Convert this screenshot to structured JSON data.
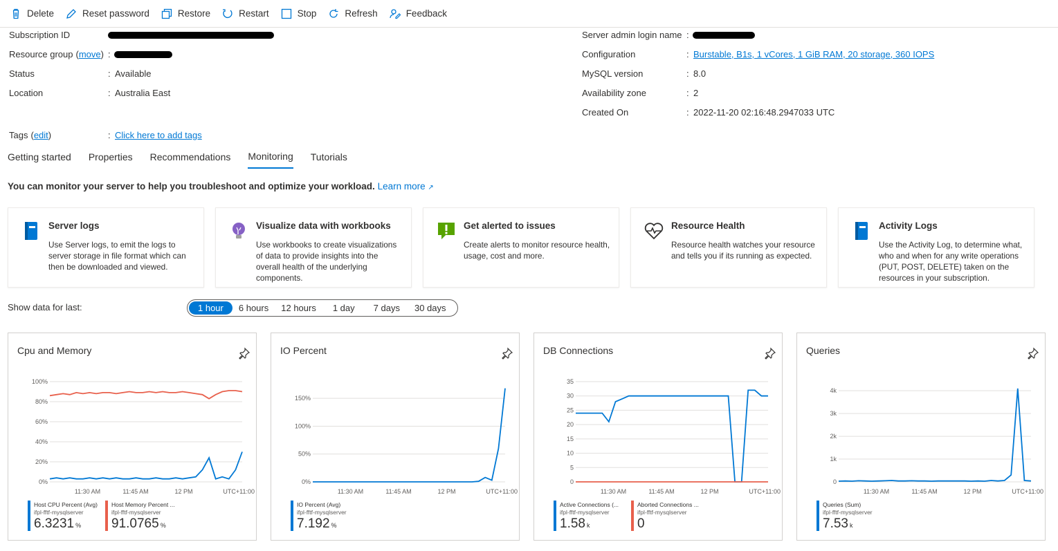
{
  "toolbar": {
    "delete": "Delete",
    "reset_password": "Reset password",
    "restore": "Restore",
    "restart": "Restart",
    "stop": "Stop",
    "refresh": "Refresh",
    "feedback": "Feedback"
  },
  "essentials": {
    "subscription_id_label": "Subscription ID",
    "resource_group_label": "Resource group",
    "move_link": "move",
    "status_label": "Status",
    "status_value": "Available",
    "location_label": "Location",
    "location_value": "Australia East",
    "admin_login_label": "Server admin login name",
    "configuration_label": "Configuration",
    "configuration_value": "Burstable, B1s, 1 vCores, 1 GiB RAM, 20 storage, 360 IOPS",
    "mysql_version_label": "MySQL version",
    "mysql_version_value": "8.0",
    "availability_zone_label": "Availability zone",
    "availability_zone_value": "2",
    "created_on_label": "Created On",
    "created_on_value": "2022-11-20 02:16:48.2947033 UTC",
    "tags_label": "Tags",
    "tags_edit_link": "edit",
    "tags_value": "Click here to add tags",
    "separator": ":"
  },
  "tabs": [
    "Getting started",
    "Properties",
    "Recommendations",
    "Monitoring",
    "Tutorials"
  ],
  "intro": {
    "text": "You can monitor your server to help you troubleshoot and optimize your workload.",
    "learn_more": "Learn more"
  },
  "cards": [
    {
      "title": "Server logs",
      "desc": "Use Server logs, to emit the logs to server storage in file format which can then be downloaded and viewed.",
      "icon": "server-logs-icon"
    },
    {
      "title": "Visualize data with workbooks",
      "desc": "Use workbooks to create visualizations of data to provide insights into the overall health of the underlying components.",
      "icon": "workbooks-icon"
    },
    {
      "title": "Get alerted to issues",
      "desc": "Create alerts to monitor resource health, usage, cost and more.",
      "icon": "alert-icon"
    },
    {
      "title": "Resource Health",
      "desc": "Resource health watches your resource and tells you if its running as expected.",
      "icon": "resource-health-icon"
    },
    {
      "title": "Activity Logs",
      "desc": "Use the Activity Log, to determine what, who and when for any write operations (PUT, POST, DELETE) taken on the resources in your subscription.",
      "icon": "activity-logs-icon"
    }
  ],
  "time_range": {
    "label": "Show data for last:",
    "options": [
      "1 hour",
      "6 hours",
      "12 hours",
      "1 day",
      "7 days",
      "30 days"
    ],
    "selected": "1 hour"
  },
  "colors": {
    "accent": "#0078d4",
    "cpu": "#0078d4",
    "memory": "#e8604c",
    "highlight": "#ffe600"
  },
  "chart_data": [
    {
      "type": "line",
      "title": "Cpu and Memory",
      "x_ticks": [
        "11:30 AM",
        "11:45 AM",
        "12 PM"
      ],
      "timezone": "UTC+11:00",
      "y_ticks": [
        "0%",
        "20%",
        "40%",
        "60%",
        "80%",
        "100%"
      ],
      "ylim": [
        0,
        100
      ],
      "series": [
        {
          "name": "Host CPU Percent (Avg)",
          "resource": "ifpl-fftf-mysqlserver",
          "summary": "6.3231",
          "unit": "%",
          "color": "#0078d4",
          "values": [
            3,
            4,
            3,
            4,
            3,
            3,
            4,
            3,
            4,
            3,
            4,
            3,
            3,
            4,
            3,
            3,
            4,
            3,
            3,
            4,
            3,
            4,
            5,
            12,
            24,
            3,
            5,
            3,
            12,
            30
          ]
        },
        {
          "name": "Host Memory Percent ...",
          "resource": "ifpl-fftf-mysqlserver",
          "summary": "91.0765",
          "unit": "%",
          "color": "#e8604c",
          "values": [
            86,
            87,
            88,
            87,
            89,
            88,
            89,
            88,
            89,
            89,
            88,
            89,
            90,
            89,
            89,
            90,
            89,
            90,
            89,
            89,
            90,
            89,
            88,
            87,
            83,
            87,
            90,
            91,
            91,
            90
          ]
        }
      ]
    },
    {
      "type": "line",
      "title": "IO Percent",
      "x_ticks": [
        "11:30 AM",
        "11:45 AM",
        "12 PM"
      ],
      "timezone": "UTC+11:00",
      "y_ticks": [
        "0%",
        "50%",
        "100%",
        "150%"
      ],
      "ylim": [
        0,
        180
      ],
      "series": [
        {
          "name": "IO Percent (Avg)",
          "resource": "ifpl-fftf-mysqlserver",
          "summary": "7.192",
          "unit": "%",
          "color": "#0078d4",
          "values": [
            0,
            0,
            0,
            0,
            0,
            0,
            0,
            0,
            0,
            0,
            0,
            0,
            0,
            0,
            0,
            0,
            0,
            0,
            0,
            0,
            0,
            0,
            0,
            0,
            0,
            1,
            8,
            3,
            60,
            168
          ]
        }
      ]
    },
    {
      "type": "line",
      "title": "DB Connections",
      "x_ticks": [
        "11:30 AM",
        "11:45 AM",
        "12 PM"
      ],
      "timezone": "UTC+11:00",
      "y_ticks": [
        "0",
        "5",
        "10",
        "15",
        "20",
        "25",
        "30",
        "35"
      ],
      "ylim": [
        0,
        35
      ],
      "series": [
        {
          "name": "Active Connections (...",
          "resource": "ifpl-fftf-mysqlserver",
          "summary": "1.58",
          "unit": "k",
          "color": "#0078d4",
          "values": [
            24,
            24,
            24,
            24,
            24,
            21,
            28,
            29,
            30,
            30,
            30,
            30,
            30,
            30,
            30,
            30,
            30,
            30,
            30,
            30,
            30,
            30,
            30,
            30,
            0,
            0,
            32,
            32,
            30,
            30
          ]
        },
        {
          "name": "Aborted Connections ...",
          "resource": "ifpl-fftf-mysqlserver",
          "summary": "0",
          "unit": "",
          "color": "#e8604c",
          "values": [
            0,
            0,
            0,
            0,
            0,
            0,
            0,
            0,
            0,
            0,
            0,
            0,
            0,
            0,
            0,
            0,
            0,
            0,
            0,
            0,
            0,
            0,
            0,
            0,
            0,
            0,
            0,
            0,
            0,
            0
          ]
        }
      ]
    },
    {
      "type": "line",
      "title": "Queries",
      "x_ticks": [
        "11:30 AM",
        "11:45 AM",
        "12 PM"
      ],
      "timezone": "UTC+11:00",
      "y_ticks": [
        "0",
        "1k",
        "2k",
        "3k",
        "4k"
      ],
      "ylim": [
        0,
        4400
      ],
      "series": [
        {
          "name": "Queries (Sum)",
          "resource": "ifpl-fftf-mysqlserver",
          "summary": "7.53",
          "unit": "k",
          "color": "#0078d4",
          "values": [
            30,
            40,
            30,
            50,
            40,
            30,
            40,
            50,
            60,
            40,
            40,
            50,
            40,
            40,
            30,
            40,
            40,
            40,
            40,
            40,
            30,
            40,
            30,
            60,
            40,
            60,
            300,
            4100,
            60,
            40
          ]
        }
      ]
    }
  ]
}
